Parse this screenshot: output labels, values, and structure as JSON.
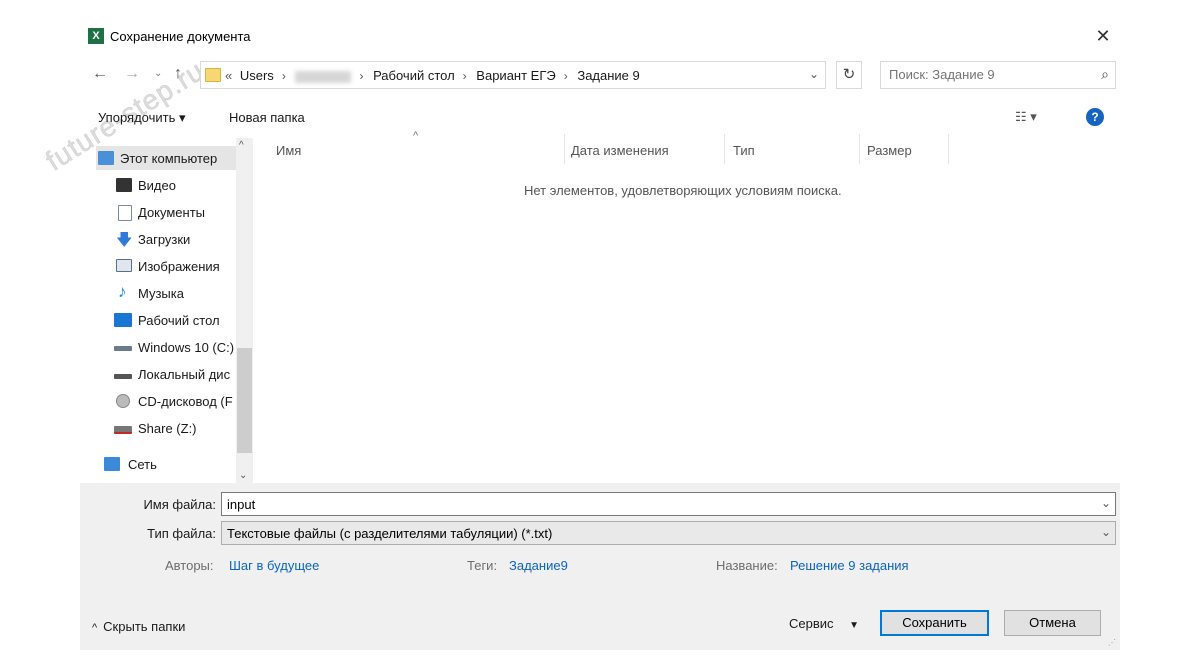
{
  "window": {
    "title": "Сохранение документа",
    "app_icon": "excel-icon",
    "close_glyph": "✕"
  },
  "watermark": "future-step.ru",
  "address_bar": {
    "prefix": "«",
    "crumbs": [
      "Users",
      "Рабочий стол",
      "Вариант ЕГЭ",
      "Задание 9"
    ],
    "hidden_crumb_note": "blurred"
  },
  "search": {
    "placeholder": "Поиск: Задание 9"
  },
  "toolbar": {
    "organize": "Упорядочить ▾",
    "new_folder": "Новая папка"
  },
  "nav_pane": {
    "items": [
      {
        "label": "Этот компьютер",
        "icon": "computer-icon",
        "color": "#4a90d9"
      },
      {
        "label": "Видео",
        "icon": "video-icon",
        "color": "#333333"
      },
      {
        "label": "Документы",
        "icon": "documents-icon",
        "color": "#7a8aa0"
      },
      {
        "label": "Загрузки",
        "icon": "downloads-icon",
        "color": "#2f7ad6"
      },
      {
        "label": "Изображения",
        "icon": "images-icon",
        "color": "#5a6f8a"
      },
      {
        "label": "Музыка",
        "icon": "music-icon",
        "color": "#1e88e5"
      },
      {
        "label": "Рабочий стол",
        "icon": "desktop-icon",
        "color": "#1976d2"
      },
      {
        "label": "Windows 10 (C:)",
        "icon": "drive-c-icon",
        "color": "#6b7b8c"
      },
      {
        "label": "Локальный дис",
        "icon": "local-disk-icon",
        "color": "#555555"
      },
      {
        "label": "CD-дисковод (F",
        "icon": "cd-drive-icon",
        "color": "#8a8a8a"
      },
      {
        "label": "Share (Z:)",
        "icon": "network-share-icon",
        "color": "#c62828"
      },
      {
        "label": "Сеть",
        "icon": "network-icon",
        "color": "#3b8ad8"
      }
    ]
  },
  "file_list": {
    "columns": [
      "Имя",
      "Дата изменения",
      "Тип",
      "Размер"
    ],
    "empty_message": "Нет элементов, удовлетворяющих условиям поиска."
  },
  "form": {
    "filename_label": "Имя файла:",
    "filename_value": "input",
    "filetype_label": "Тип файла:",
    "filetype_value": "Текстовые файлы (с разделителями табуляции) (*.txt)",
    "authors_label": "Авторы:",
    "authors_value": "Шаг в будущее",
    "tags_label": "Теги:",
    "tags_value": "Задание9",
    "title_label": "Название:",
    "title_value": "Решение 9 задания"
  },
  "footer": {
    "hide_folders": "Скрыть папки",
    "service": "Сервис",
    "save": "Сохранить",
    "cancel": "Отмена"
  }
}
